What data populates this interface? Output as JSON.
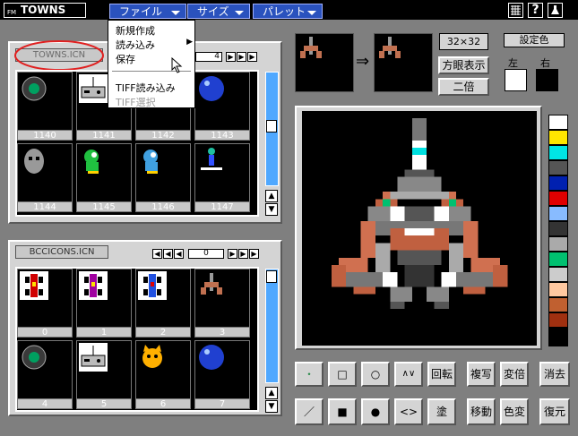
{
  "topbar": {
    "logo_prefix": "FM",
    "logo": "TOWNS",
    "menus": [
      {
        "label": "ファイル"
      },
      {
        "label": "サイズ"
      },
      {
        "label": "パレット"
      }
    ],
    "sys_icons": [
      "grid-icon",
      "help-icon",
      "flask-icon"
    ]
  },
  "file_menu": {
    "items": [
      {
        "label": "新規作成",
        "enabled": true
      },
      {
        "label": "読み込み",
        "enabled": true,
        "submenu": true
      },
      {
        "label": "保存",
        "enabled": true
      },
      {
        "label": "TIFF読み込み",
        "enabled": true
      },
      {
        "label": "TIFF選択",
        "enabled": false
      }
    ]
  },
  "upper_file": {
    "name": "TOWNS.ICN",
    "page": "4",
    "cells": [
      {
        "num": "1140",
        "icon": "disc-icon"
      },
      {
        "num": "1141",
        "icon": "gamepad-icon"
      },
      {
        "num": "1142",
        "icon": "empty"
      },
      {
        "num": "1143",
        "icon": "bowling-ball-icon"
      },
      {
        "num": "1144",
        "icon": "hockey-mask-icon"
      },
      {
        "num": "1145",
        "icon": "dragon-green-icon"
      },
      {
        "num": "1146",
        "icon": "dragon-blue-icon"
      },
      {
        "num": "1147",
        "icon": "skater-icon"
      }
    ]
  },
  "lower_file": {
    "name": "BCCICONS.ICN",
    "page": "0",
    "cells": [
      {
        "num": "0",
        "icon": "racecar-red-icon"
      },
      {
        "num": "1",
        "icon": "racecar-purple-icon"
      },
      {
        "num": "2",
        "icon": "racecar-blue-icon"
      },
      {
        "num": "3",
        "icon": "spaceship-icon"
      },
      {
        "num": "4",
        "icon": "disc-icon"
      },
      {
        "num": "5",
        "icon": "gamepad-icon"
      },
      {
        "num": "6",
        "icon": "cat-icon"
      },
      {
        "num": "7",
        "icon": "bowling-ball-icon"
      }
    ]
  },
  "editor": {
    "size_label": "32×32",
    "grid_toggle": "方眼表示",
    "zoom_toggle": "二倍",
    "color_setting": "設定色",
    "left_label": "左",
    "right_label": "右",
    "left_color": "#ffffff",
    "right_color": "#000000"
  },
  "palette": [
    "#ffffff",
    "#ffe600",
    "#00e5e5",
    "#555555",
    "#0020b0",
    "#e00000",
    "#88bbff",
    "#333333",
    "#aaaaaa",
    "#00c070",
    "#cccccc",
    "#ffc8a0",
    "#c06030",
    "#a03010",
    "#000000"
  ],
  "tools": {
    "row1": [
      "・",
      "□",
      "○",
      "∧∨",
      "回転",
      "複写",
      "変倍",
      "消去"
    ],
    "row2": [
      "／",
      "■",
      "●",
      "<>",
      "塗",
      "移動",
      "色変",
      "復元"
    ]
  }
}
